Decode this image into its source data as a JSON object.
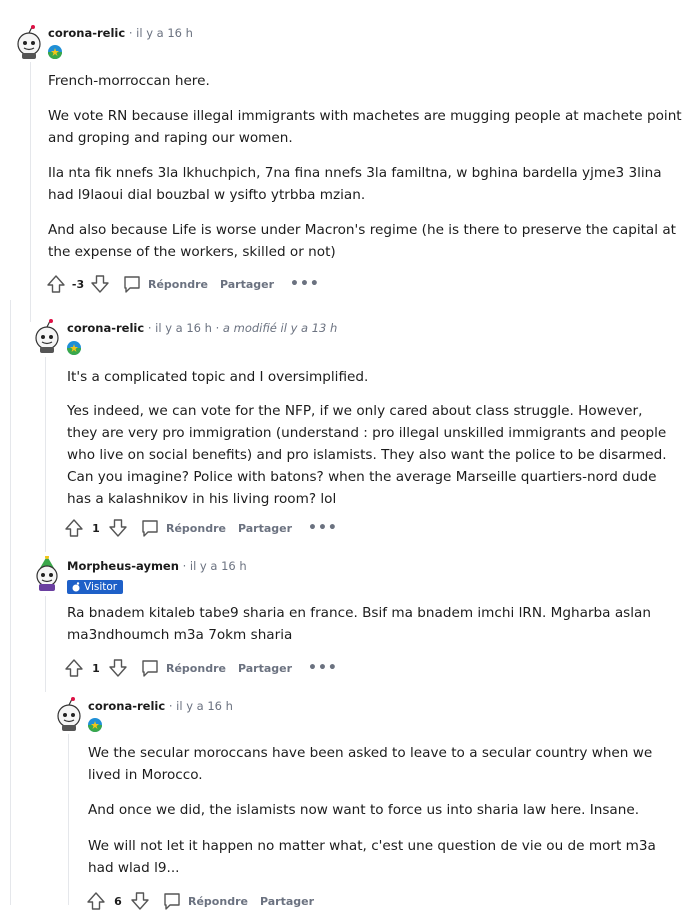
{
  "comments": [
    {
      "author": "corona-relic",
      "time": "il y a 16 h",
      "edited": "",
      "paragraphs": [
        "French-morroccan here.",
        "We vote RN because illegal immigrants with machetes are mugging people at machete point and groping and raping our women.",
        "Ila nta fik nnefs 3la lkhuchpich, 7na fina nnefs 3la familtna, w bghina bardella yjme3 3lina had l9laoui dial bouzbal w ysifto ytrbba mzian.",
        "And also because Life is worse under Macron's regime (he is there to preserve the capital at the expense of the workers, skilled or not)"
      ],
      "score": "-3",
      "reply_label": "Répondre",
      "share_label": "Partager",
      "more_label": "•••"
    },
    {
      "author": "corona-relic",
      "time": "il y a 16 h",
      "edited": "a modifié il y a 13 h",
      "paragraphs": [
        "It's a complicated topic and I oversimplified.",
        "Yes indeed, we can vote for the NFP, if we only cared about class struggle. However, they are very pro immigration (understand : pro illegal unskilled immigrants and people who live on social benefits) and pro islamists. They also want the police to be disarmed. Can you imagine? Police with batons? when the average Marseille quartiers-nord dude has a kalashnikov in his living room? lol"
      ],
      "score": "1",
      "reply_label": "Répondre",
      "share_label": "Partager",
      "more_label": "•••"
    },
    {
      "author": "Morpheus-aymen",
      "time": "il y a 16 h",
      "edited": "",
      "badge": "Visitor",
      "paragraphs": [
        "Ra bnadem kitaleb tabe9 sharia en france. Bsif ma bnadem imchi lRN. Mgharba aslan ma3ndhoumch m3a 7okm sharia"
      ],
      "score": "1",
      "reply_label": "Répondre",
      "share_label": "Partager",
      "more_label": "•••"
    },
    {
      "author": "corona-relic",
      "time": "il y a 16 h",
      "edited": "",
      "paragraphs": [
        "We the secular moroccans have been asked to leave to a secular country when we lived in Morocco.",
        "And once we did, the islamists now want to force us into sharia law here. Insane.",
        "We will not let it happen no matter what, c'est une question de vie ou de mort m3a had wlad l9..."
      ],
      "score": "6",
      "reply_label": "Répondre",
      "share_label": "Partager",
      "more_label": ""
    }
  ],
  "separator": "·",
  "icons": {
    "avatar": "snoo-avatar-icon",
    "flair": "flag-flair-icon",
    "upvote": "upvote-arrow-icon",
    "downvote": "downvote-arrow-icon",
    "reply": "speech-bubble-icon"
  },
  "colors": {
    "badge": "#1e60c8",
    "thread_line": "#e5e7eb",
    "flair_blue": "#1f8fd6",
    "flair_green": "#3aa84a",
    "flair_yellow": "#f2c518"
  }
}
